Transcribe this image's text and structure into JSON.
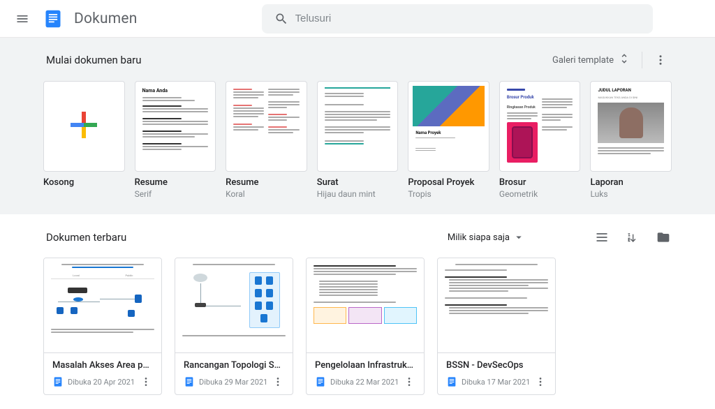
{
  "header": {
    "app_title": "Dokumen",
    "search_placeholder": "Telusuri"
  },
  "templates": {
    "section_title": "Mulai dokumen baru",
    "gallery_label": "Galeri template",
    "items": [
      {
        "name": "Kosong",
        "sub": ""
      },
      {
        "name": "Resume",
        "sub": "Serif"
      },
      {
        "name": "Resume",
        "sub": "Koral"
      },
      {
        "name": "Surat",
        "sub": "Hijau daun mint"
      },
      {
        "name": "Proposal Proyek",
        "sub": "Tropis"
      },
      {
        "name": "Brosur",
        "sub": "Geometrik"
      },
      {
        "name": "Laporan",
        "sub": "Luks"
      }
    ]
  },
  "recent": {
    "section_title": "Dokumen terbaru",
    "owner_filter": "Milik siapa saja",
    "docs": [
      {
        "title": "Masalah Akses Area pada ...",
        "date": "Dibuka 20 Apr 2021"
      },
      {
        "title": "Rancangan Topologi Serv...",
        "date": "Dibuka 29 Mar 2021"
      },
      {
        "title": "Pengelolaan Infrastruktur...",
        "date": "Dibuka 22 Mar 2021"
      },
      {
        "title": "BSSN - DevSecOps",
        "date": "Dibuka 17 Mar 2021"
      }
    ]
  },
  "preview_text": {
    "nama_anda": "Nama Anda",
    "nama_proyek": "Nama Proyek",
    "brosur_produk": "Brosur Produk",
    "ringkasan": "Ringkasan Produk",
    "judul_laporan": "JUDUL LAPORAN",
    "sub_laporan": "MASUKKAN TEKS ANDA DI SINI"
  }
}
